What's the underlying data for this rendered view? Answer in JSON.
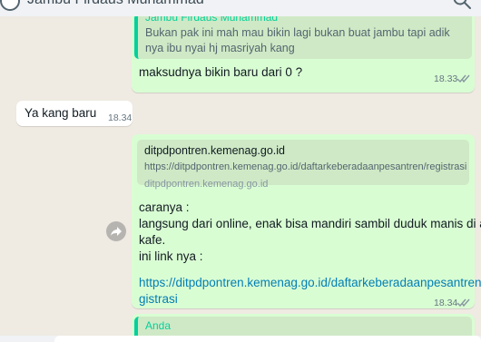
{
  "header": {
    "contact_name": "Jambu Firdaus Muhammad"
  },
  "messages": {
    "m1": {
      "quote_author": "Jambu Firdaus Muhammad",
      "quote_text": "Bukan pak ini mah mau bikin lagi bukan buat jambu tapi adik nya ibu nyai hj masriyah kang",
      "text": "maksudnya bikin baru dari 0 ?",
      "time": "18.33"
    },
    "m2": {
      "text": "Ya kang baru",
      "time": "18.34"
    },
    "m3": {
      "preview_title": "ditpdpontren.kemenag.go.id",
      "preview_url": "https://ditpdpontren.kemenag.go.id/daftarkeberadaanpesantren/registrasi",
      "preview_domain": "ditpdpontren.kemenag.go.id",
      "line1": "caranya :",
      "line2": "langsung dari online, enak bisa mandiri sambil duduk manis di atas",
      "line3": "kafe.",
      "line4": "ini link nya :",
      "link_line1": "https://ditpdpontren.kemenag.go.id/daftarkeberadaanpesantren/re",
      "link_line2": "gistrasi",
      "time": "18.34"
    },
    "m4": {
      "quote_author": "Anda"
    }
  },
  "colors": {
    "outgoing_bubble": "#d9fdd3",
    "incoming_bubble": "#ffffff",
    "quote_accent": "#06cf9c",
    "link": "#027eb5",
    "chat_background": "#efeae2"
  }
}
